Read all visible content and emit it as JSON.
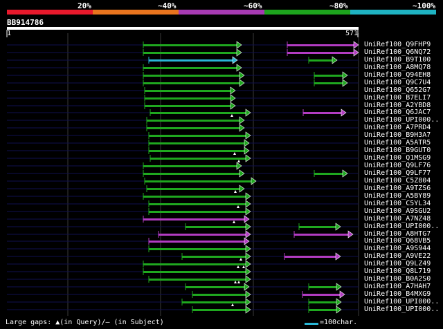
{
  "legend": {
    "labels": [
      "20%",
      "~40%",
      "~60%",
      "~80%",
      "~100%"
    ],
    "colors": [
      "#e8192c",
      "#e8741e",
      "#a63ab2",
      "#1da31d",
      "#1fb3c2"
    ]
  },
  "query": {
    "name": "BB914786",
    "start": "1",
    "end": "571"
  },
  "colors": {
    "green": "#1fa81f",
    "magenta": "#b23cc2",
    "cyan": "#29b6d6",
    "row_line": "#101050",
    "grid": "#3a3a3a"
  },
  "hits": [
    {
      "label": "UniRef100_Q9FHP9",
      "segs": [
        {
          "s": 207,
          "e": 349,
          "c": "green"
        },
        {
          "s": 415,
          "e": 518,
          "c": "magenta"
        }
      ],
      "gaps": []
    },
    {
      "label": "UniRef100_Q6NQ72",
      "segs": [
        {
          "s": 207,
          "e": 349,
          "c": "green"
        },
        {
          "s": 415,
          "e": 518,
          "c": "magenta"
        }
      ],
      "gaps": []
    },
    {
      "label": "UniRef100_B9T100",
      "segs": [
        {
          "s": 215,
          "e": 343,
          "c": "cyan"
        },
        {
          "s": 446,
          "e": 487,
          "c": "green"
        }
      ],
      "gaps": []
    },
    {
      "label": "UniRef100_A8MQ78",
      "segs": [
        {
          "s": 207,
          "e": 349,
          "c": "green"
        }
      ],
      "gaps": []
    },
    {
      "label": "UniRef100_Q94EH8",
      "segs": [
        {
          "s": 207,
          "e": 353,
          "c": "green"
        },
        {
          "s": 454,
          "e": 502,
          "c": "green"
        }
      ],
      "gaps": []
    },
    {
      "label": "UniRef100_Q9C7U4",
      "segs": [
        {
          "s": 207,
          "e": 353,
          "c": "green"
        },
        {
          "s": 454,
          "e": 502,
          "c": "green"
        }
      ],
      "gaps": []
    },
    {
      "label": "UniRef100_Q652G7",
      "segs": [
        {
          "s": 209,
          "e": 340,
          "c": "green"
        }
      ],
      "gaps": []
    },
    {
      "label": "UniRef100_B7ELI7",
      "segs": [
        {
          "s": 209,
          "e": 340,
          "c": "green"
        }
      ],
      "gaps": []
    },
    {
      "label": "UniRef100_A2YBD8",
      "segs": [
        {
          "s": 209,
          "e": 340,
          "c": "green"
        }
      ],
      "gaps": []
    },
    {
      "label": "UniRef100_Q6JAC7",
      "segs": [
        {
          "s": 217,
          "e": 362,
          "c": "green"
        },
        {
          "s": 438,
          "e": 500,
          "c": "magenta"
        }
      ],
      "gaps": [
        335
      ]
    },
    {
      "label": "UniRef100_UPI000..",
      "segs": [
        {
          "s": 212,
          "e": 353,
          "c": "green"
        }
      ],
      "gaps": []
    },
    {
      "label": "UniRef100_A7PRD4",
      "segs": [
        {
          "s": 212,
          "e": 353,
          "c": "green"
        }
      ],
      "gaps": []
    },
    {
      "label": "UniRef100_B9H3A7",
      "segs": [
        {
          "s": 215,
          "e": 362,
          "c": "green"
        }
      ],
      "gaps": []
    },
    {
      "label": "UniRef100_A5ATR5",
      "segs": [
        {
          "s": 215,
          "e": 360,
          "c": "green"
        }
      ],
      "gaps": []
    },
    {
      "label": "UniRef100_B9GUT0",
      "segs": [
        {
          "s": 215,
          "e": 360,
          "c": "green"
        }
      ],
      "gaps": [
        339
      ]
    },
    {
      "label": "UniRef100_Q1MSG9",
      "segs": [
        {
          "s": 217,
          "e": 362,
          "c": "green"
        }
      ],
      "gaps": [
        345
      ]
    },
    {
      "label": "UniRef100_Q9LF76",
      "segs": [
        {
          "s": 207,
          "e": 349,
          "c": "green"
        }
      ],
      "gaps": []
    },
    {
      "label": "UniRef100_Q9LF77",
      "segs": [
        {
          "s": 207,
          "e": 353,
          "c": "green"
        },
        {
          "s": 454,
          "e": 502,
          "c": "green"
        }
      ],
      "gaps": []
    },
    {
      "label": "UniRef100_C5Z804",
      "segs": [
        {
          "s": 209,
          "e": 370,
          "c": "green"
        }
      ],
      "gaps": []
    },
    {
      "label": "UniRef100_A9TZS6",
      "segs": [
        {
          "s": 212,
          "e": 353,
          "c": "green"
        }
      ],
      "gaps": [
        340
      ]
    },
    {
      "label": "UniRef100_A5BY89",
      "segs": [
        {
          "s": 207,
          "e": 362,
          "c": "green"
        }
      ],
      "gaps": []
    },
    {
      "label": "UniRef100_C5YL34",
      "segs": [
        {
          "s": 215,
          "e": 362,
          "c": "green"
        }
      ],
      "gaps": [
        344
      ]
    },
    {
      "label": "UniRef100_A9SGU2",
      "segs": [
        {
          "s": 215,
          "e": 362,
          "c": "green"
        }
      ],
      "gaps": []
    },
    {
      "label": "UniRef100_A7NZ48",
      "segs": [
        {
          "s": 207,
          "e": 360,
          "c": "magenta"
        }
      ],
      "gaps": [
        338
      ]
    },
    {
      "label": "UniRef100_UPI000..",
      "segs": [
        {
          "s": 268,
          "e": 362,
          "c": "green"
        },
        {
          "s": 432,
          "e": 492,
          "c": "green"
        }
      ],
      "gaps": []
    },
    {
      "label": "UniRef100_A8HTG7",
      "segs": [
        {
          "s": 229,
          "e": 362,
          "c": "magenta"
        },
        {
          "s": 425,
          "e": 510,
          "c": "magenta"
        }
      ],
      "gaps": []
    },
    {
      "label": "UniRef100_Q68VB5",
      "segs": [
        {
          "s": 215,
          "e": 360,
          "c": "magenta"
        }
      ],
      "gaps": []
    },
    {
      "label": "UniRef100_A9S944",
      "segs": [
        {
          "s": 215,
          "e": 362,
          "c": "green"
        }
      ],
      "gaps": []
    },
    {
      "label": "UniRef100_A9VE22",
      "segs": [
        {
          "s": 263,
          "e": 362,
          "c": "green"
        },
        {
          "s": 411,
          "e": 492,
          "c": "magenta"
        }
      ],
      "gaps": [
        348
      ]
    },
    {
      "label": "UniRef100_Q9LZ49",
      "segs": [
        {
          "s": 207,
          "e": 362,
          "c": "green"
        }
      ],
      "gaps": [
        344,
        352
      ]
    },
    {
      "label": "UniRef100_Q8L719",
      "segs": [
        {
          "s": 207,
          "e": 362,
          "c": "green"
        }
      ],
      "gaps": []
    },
    {
      "label": "UniRef100_B0A2S0",
      "segs": [
        {
          "s": 215,
          "e": 362,
          "c": "green"
        }
      ],
      "gaps": [
        340,
        345
      ]
    },
    {
      "label": "UniRef100_A7HAH7",
      "segs": [
        {
          "s": 268,
          "e": 360,
          "c": "green"
        },
        {
          "s": 446,
          "e": 493,
          "c": "green"
        }
      ],
      "gaps": []
    },
    {
      "label": "UniRef100_B4MXG9",
      "segs": [
        {
          "s": 278,
          "e": 362,
          "c": "green"
        },
        {
          "s": 437,
          "e": 498,
          "c": "magenta"
        }
      ],
      "gaps": []
    },
    {
      "label": "UniRef100_UPI000..",
      "segs": [
        {
          "s": 263,
          "e": 362,
          "c": "green"
        },
        {
          "s": 446,
          "e": 493,
          "c": "green"
        }
      ],
      "gaps": [
        336
      ]
    },
    {
      "label": "UniRef100_UPI000..",
      "segs": [
        {
          "s": 278,
          "e": 362,
          "c": "green"
        },
        {
          "s": 446,
          "e": 493,
          "c": "green"
        }
      ],
      "gaps": []
    }
  ],
  "footer": {
    "note": "Large gaps: ▲(in Query)/— (in Subject)",
    "scale": "=100char."
  }
}
